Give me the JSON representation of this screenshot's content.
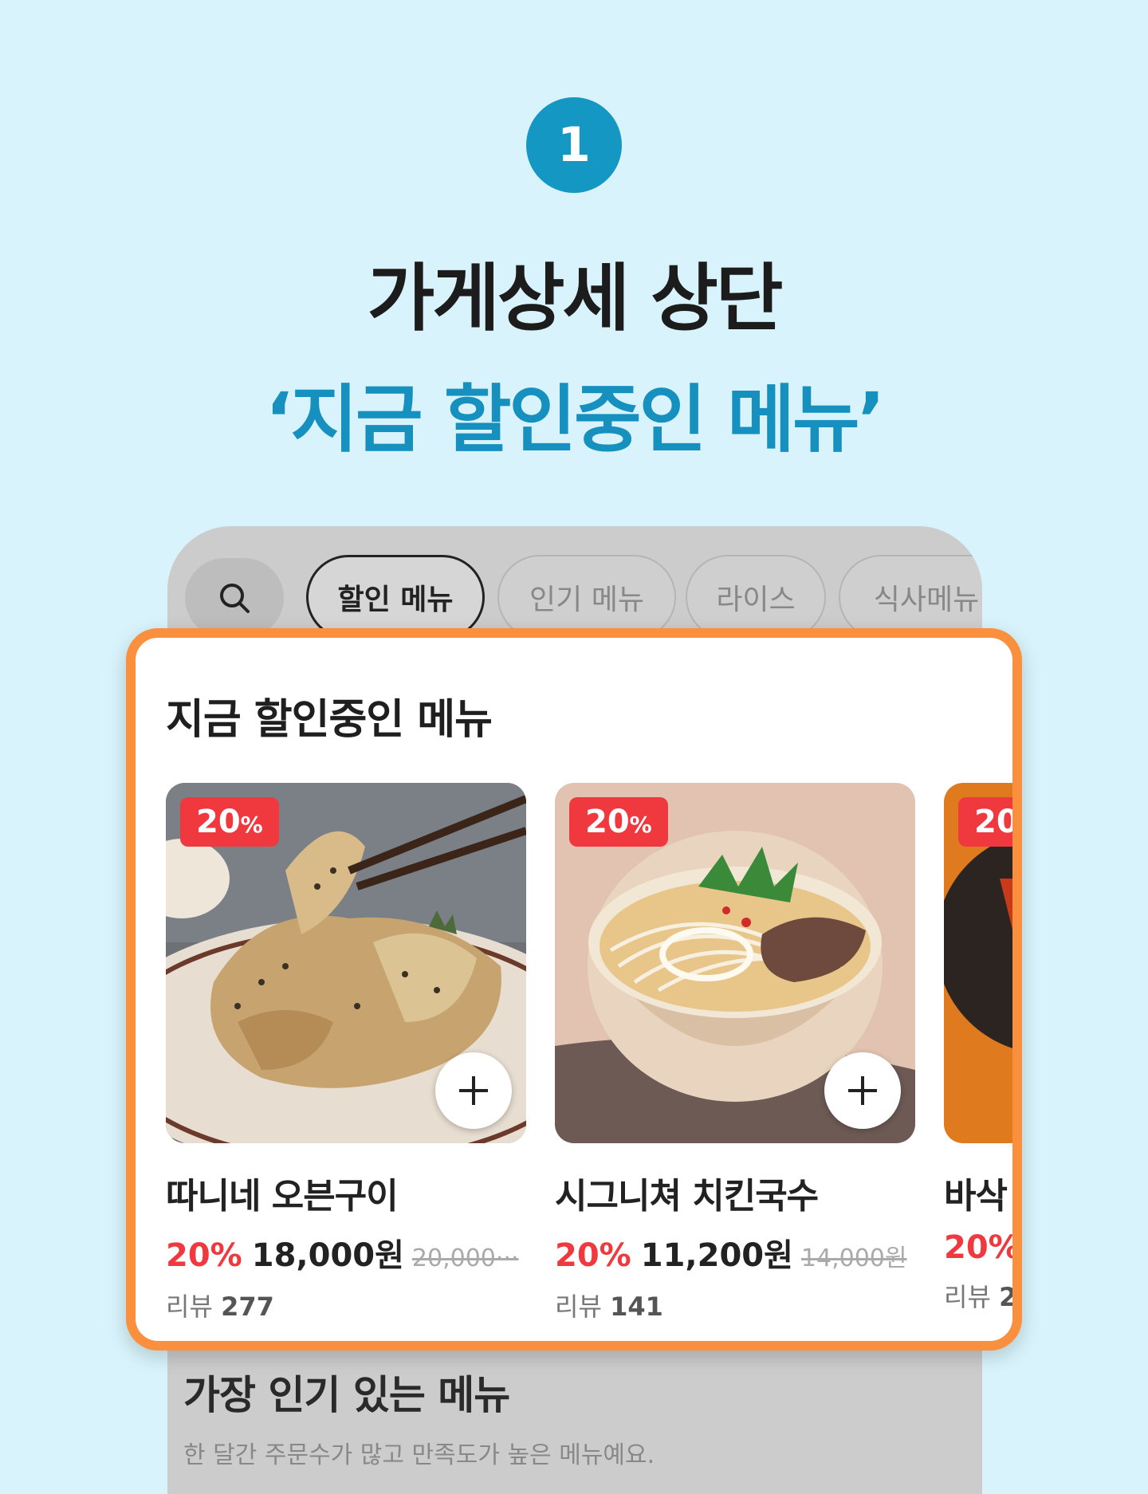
{
  "header": {
    "step_number": "1",
    "title_line1": "가게상세 상단",
    "title_line2": "‘지금 할인중인 메뉴’"
  },
  "tabs": [
    {
      "label": "할인 메뉴",
      "active": true
    },
    {
      "label": "인기 메뉴",
      "active": false
    },
    {
      "label": "라이스",
      "active": false
    },
    {
      "label": "식사메뉴",
      "active": false
    }
  ],
  "discount_section": {
    "title": "지금 할인중인 메뉴",
    "items": [
      {
        "badge_rate": "20",
        "badge_unit": "%",
        "name": "따니네 오븐구이",
        "rate": "20%",
        "price": "18,000원",
        "original_price": "20,000···",
        "review_label": "리뷰",
        "review_count": "277"
      },
      {
        "badge_rate": "20",
        "badge_unit": "%",
        "name": "시그니쳐 치킨국수",
        "rate": "20%",
        "price": "11,200원",
        "original_price": "14,000원",
        "review_label": "리뷰",
        "review_count": "141"
      },
      {
        "badge_rate": "20",
        "badge_unit": "",
        "name": "바삭",
        "rate": "20%",
        "price": "",
        "original_price": "",
        "review_label": "리뷰",
        "review_count": "2"
      }
    ]
  },
  "popular_section": {
    "title": "가장 인기 있는 메뉴",
    "description": "한 달간 주문수가 많고 만족도가 높은 메뉴예요."
  },
  "colors": {
    "background": "#d8f3fb",
    "accent_blue": "#1590bf",
    "highlight_border": "#fa8f3e",
    "discount_red": "#f0383f"
  }
}
